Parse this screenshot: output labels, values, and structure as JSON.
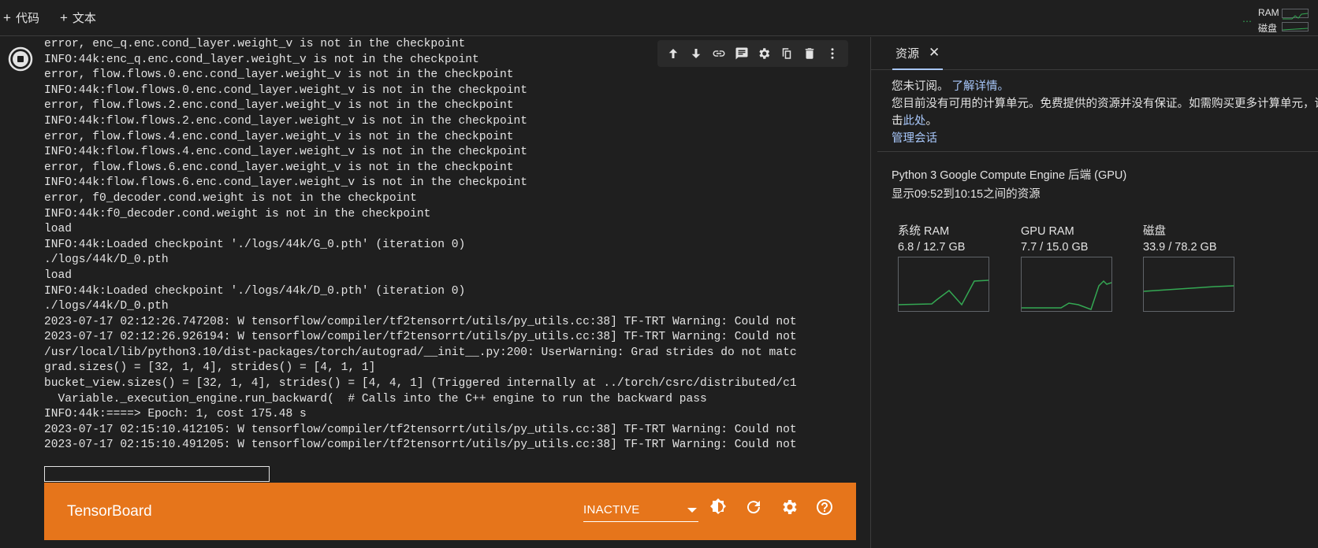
{
  "toolbar": {
    "add_code": "代码",
    "add_text": "文本",
    "ram_label": "RAM",
    "disk_label": "磁盘"
  },
  "output": {
    "lines": [
      "error, enc_q.enc.cond_layer.weight_v is not in the checkpoint",
      "INFO:44k:enc_q.enc.cond_layer.weight_v is not in the checkpoint",
      "error, flow.flows.0.enc.cond_layer.weight_v is not in the checkpoint",
      "INFO:44k:flow.flows.0.enc.cond_layer.weight_v is not in the checkpoint",
      "error, flow.flows.2.enc.cond_layer.weight_v is not in the checkpoint",
      "INFO:44k:flow.flows.2.enc.cond_layer.weight_v is not in the checkpoint",
      "error, flow.flows.4.enc.cond_layer.weight_v is not in the checkpoint",
      "INFO:44k:flow.flows.4.enc.cond_layer.weight_v is not in the checkpoint",
      "error, flow.flows.6.enc.cond_layer.weight_v is not in the checkpoint",
      "INFO:44k:flow.flows.6.enc.cond_layer.weight_v is not in the checkpoint",
      "error, f0_decoder.cond.weight is not in the checkpoint",
      "INFO:44k:f0_decoder.cond.weight is not in the checkpoint",
      "load",
      "INFO:44k:Loaded checkpoint './logs/44k/G_0.pth' (iteration 0)",
      "./logs/44k/D_0.pth",
      "load",
      "INFO:44k:Loaded checkpoint './logs/44k/D_0.pth' (iteration 0)",
      "./logs/44k/D_0.pth",
      "2023-07-17 02:12:26.747208: W tensorflow/compiler/tf2tensorrt/utils/py_utils.cc:38] TF-TRT Warning: Could not",
      "2023-07-17 02:12:26.926194: W tensorflow/compiler/tf2tensorrt/utils/py_utils.cc:38] TF-TRT Warning: Could not",
      "/usr/local/lib/python3.10/dist-packages/torch/autograd/__init__.py:200: UserWarning: Grad strides do not matc",
      "grad.sizes() = [32, 1, 4], strides() = [4, 1, 1]",
      "bucket_view.sizes() = [32, 1, 4], strides() = [4, 4, 1] (Triggered internally at ../torch/csrc/distributed/c1",
      "  Variable._execution_engine.run_backward(  # Calls into the C++ engine to run the backward pass",
      "INFO:44k:====> Epoch: 1, cost 175.48 s",
      "2023-07-17 02:15:10.412105: W tensorflow/compiler/tf2tensorrt/utils/py_utils.cc:38] TF-TRT Warning: Could not",
      "2023-07-17 02:15:10.491205: W tensorflow/compiler/tf2tensorrt/utils/py_utils.cc:38] TF-TRT Warning: Could not"
    ]
  },
  "cell_toolbar": {
    "icons": [
      "arrow-up-icon",
      "arrow-down-icon",
      "link-icon",
      "comment-icon",
      "gear-icon",
      "mirror-cell-icon",
      "delete-icon",
      "more-vert-icon"
    ]
  },
  "tensorboard": {
    "title": "TensorBoard",
    "status_value": "INACTIVE"
  },
  "resources": {
    "tab_label": "资源",
    "close_glyph": "✕",
    "not_subscribed": "您未订阅。",
    "learn_more": "了解详情。",
    "no_units_line": "您目前没有可用的计算单元。免费提供的资源并没有保证。如需购买更多计算单元，请点",
    "click_prefix": "击",
    "here_link": "此处",
    "period": "。",
    "manage_sessions": "管理会话",
    "backend": "Python 3 Google Compute Engine 后端 (GPU)",
    "time_range": "显示09:52到10:15之间的资源",
    "metrics": [
      {
        "name": "系统 RAM",
        "value": "6.8 / 12.7 GB"
      },
      {
        "name": "GPU RAM",
        "value": "7.7 / 15.0 GB"
      },
      {
        "name": "磁盘",
        "value": "33.9 / 78.2 GB"
      }
    ]
  },
  "colors": {
    "accent_orange": "#e6751b",
    "graph_green": "#34a853",
    "link_blue": "#a8c7fa"
  }
}
